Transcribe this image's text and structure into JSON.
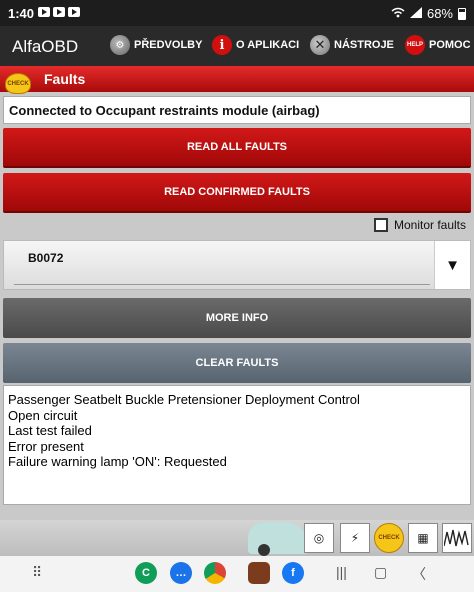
{
  "status_bar": {
    "time": "1:40",
    "battery": "68%"
  },
  "app_bar": {
    "title": "AlfaOBD",
    "menu": [
      {
        "label": "PŘEDVOLBY",
        "icon": "preferences-icon"
      },
      {
        "label": "O APLIKACI",
        "icon": "info-icon"
      },
      {
        "label": "NÁSTROJE",
        "icon": "tools-icon"
      },
      {
        "label": "POMOC",
        "icon": "help-icon"
      }
    ],
    "help_icon_text": "HELP"
  },
  "section": {
    "badge": "CHECK",
    "title": "Faults"
  },
  "connected_text": "Connected to Occupant restraints module (airbag)",
  "buttons": {
    "read_all": "READ ALL FAULTS",
    "read_confirmed": "READ CONFIRMED FAULTS",
    "more_info": "MORE INFO",
    "clear_faults": "CLEAR FAULTS"
  },
  "monitor_faults": {
    "label": "Monitor faults",
    "checked": false
  },
  "fault_select": {
    "selected": "B0072",
    "arrow": "▼"
  },
  "fault_details": [
    "Passenger Seatbelt Buckle Pretensioner Deployment Control",
    "Open circuit",
    "Last test failed",
    "Error present",
    "Failure warning lamp 'ON': Requested"
  ],
  "bottom_strip": {
    "check_badge": "CHECK"
  },
  "colors": {
    "accent_red": "#d21818",
    "app_bar": "#2a2a2a"
  }
}
